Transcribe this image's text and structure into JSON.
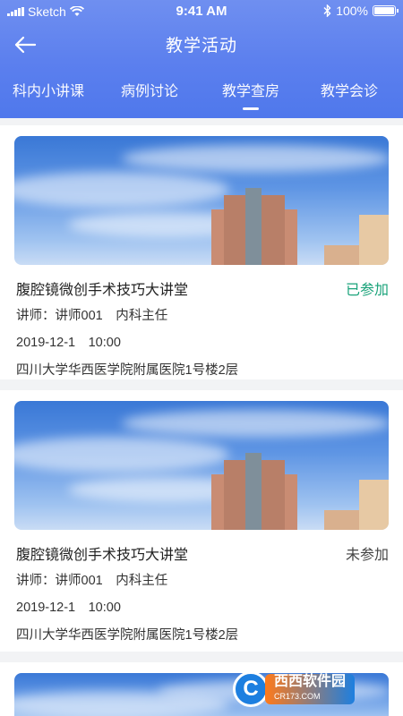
{
  "status_bar": {
    "carrier": "Sketch",
    "time": "9:41 AM",
    "battery": "100%"
  },
  "nav": {
    "title": "教学活动"
  },
  "tabs": [
    {
      "label": "科内小讲课",
      "active": false
    },
    {
      "label": "病例讨论",
      "active": false
    },
    {
      "label": "教学查房",
      "active": true
    },
    {
      "label": "教学会诊",
      "active": false
    }
  ],
  "activities": [
    {
      "title": "腹腔镜微创手术技巧大讲堂",
      "status": "已参加",
      "status_color": "#1aa37a",
      "lecturer": "讲师：讲师001　内科主任",
      "datetime": "2019-12-1　10:00",
      "location": "四川大学华西医学院附属医院1号楼2层"
    },
    {
      "title": "腹腔镜微创手术技巧大讲堂",
      "status": "未参加",
      "status_color": "#444444",
      "lecturer": "讲师：讲师001　内科主任",
      "datetime": "2019-12-1　10:00",
      "location": "四川大学华西医学院附属医院1号楼2层"
    }
  ],
  "watermark": {
    "logo_text": "C",
    "brand": "西西软件园",
    "domain": "CR173.COM"
  }
}
